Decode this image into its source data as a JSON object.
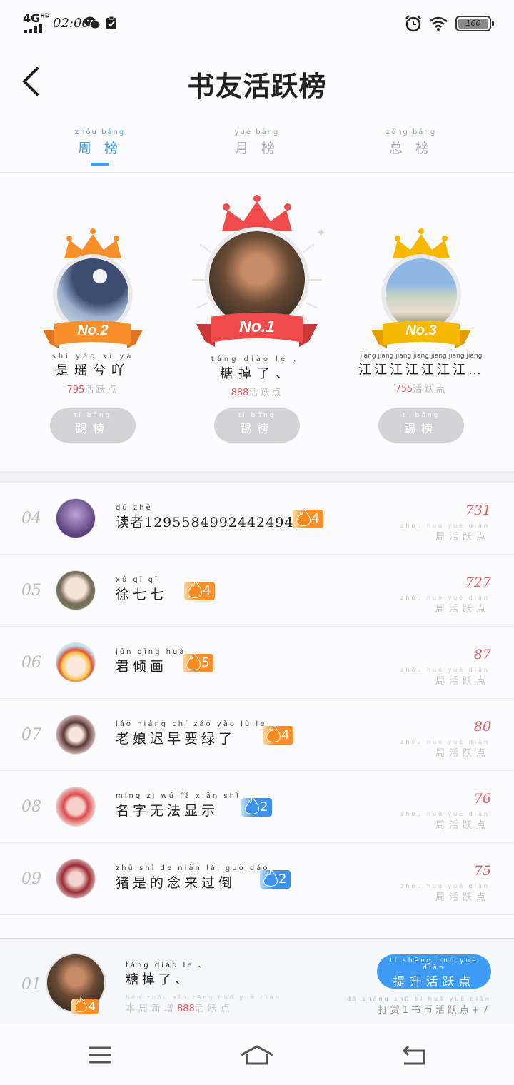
{
  "status": {
    "signal": "4G",
    "signal_sup": "HD",
    "time": "02:06",
    "battery": "100"
  },
  "header": {
    "title": "书友活跃榜"
  },
  "tabs": [
    {
      "pinyin": "zhōu bǎng",
      "label": "周 榜",
      "active": true
    },
    {
      "pinyin": "yuè bǎng",
      "label": "月 榜",
      "active": false
    },
    {
      "pinyin": "zǒng bǎng",
      "label": "总 榜",
      "active": false
    }
  ],
  "podium": {
    "first": {
      "rank_label": "No.1",
      "name_pinyin": "táng diào le 、",
      "name": "糖掉了、",
      "score": "888",
      "score_pinyin": "huó yuè diǎn",
      "score_label": "活跃点",
      "kick_pinyin": "tī bǎng",
      "kick_label": "踢榜"
    },
    "second": {
      "rank_label": "No.2",
      "name_pinyin": "shì yáo xī yā",
      "name": "是瑶兮吖",
      "score": "795",
      "score_pinyin": "huó yuè diǎn",
      "score_label": "活跃点",
      "kick_pinyin": "tī bǎng",
      "kick_label": "踢榜"
    },
    "third": {
      "rank_label": "No.3",
      "name_pinyin": "jiāng jiāng jiāng jiāng jiāng jiāng jiāng",
      "name": "江江江江江江江…",
      "score": "755",
      "score_pinyin": "huó yuè diǎn",
      "score_label": "活跃点",
      "kick_pinyin": "tī bǎng",
      "kick_label": "踢榜"
    }
  },
  "list": [
    {
      "rank": "04",
      "name_pinyin": "dú zhě",
      "name": "读者1295584992442494976",
      "level": "4",
      "level_color": "orange",
      "score": "731",
      "label_pinyin": "zhōu huó yuè diǎn",
      "label": "周活跃点"
    },
    {
      "rank": "05",
      "name_pinyin": "xú qī qī",
      "name": "徐七七",
      "level": "4",
      "level_color": "orange",
      "score": "727",
      "label_pinyin": "zhōu huó yuè diǎn",
      "label": "周活跃点"
    },
    {
      "rank": "06",
      "name_pinyin": "jūn qīng huà",
      "name": "君倾画",
      "level": "5",
      "level_color": "orange",
      "score": "87",
      "label_pinyin": "zhōu huó yuè diǎn",
      "label": "周活跃点"
    },
    {
      "rank": "07",
      "name_pinyin": "lǎo niáng chí zǎo yào lǜ le",
      "name": "老娘迟早要绿了",
      "level": "4",
      "level_color": "orange",
      "score": "80",
      "label_pinyin": "zhōu huó yuè diǎn",
      "label": "周活跃点"
    },
    {
      "rank": "08",
      "name_pinyin": "míng zì wú fǎ xiǎn shì",
      "name": "名字无法显示",
      "level": "2",
      "level_color": "blue",
      "score": "76",
      "label_pinyin": "zhōu huó yuè diǎn",
      "label": "周活跃点"
    },
    {
      "rank": "09",
      "name_pinyin": "zhū shì de niàn lái guò dǎo",
      "name": "猪是的念来过倒",
      "level": "2",
      "level_color": "blue",
      "score": "75",
      "label_pinyin": "zhōu huó yuè diǎn",
      "label": "周活跃点"
    }
  ],
  "mine": {
    "rank": "01",
    "level": "4",
    "name_pinyin": "táng diào le 、",
    "name": "糖掉了、",
    "sub_pinyin": "běn zhōu xīn zēng huó yuè diǎn",
    "sub_prefix": "本周新增",
    "sub_value": "888",
    "sub_suffix": "活跃点",
    "boost_pinyin": "tí shēng huó yuè diǎn",
    "boost_label": "提升活跃点",
    "hint_pinyin": "dǎ shǎng shū bì huó yuè diǎn",
    "hint_label": "打赏1书币活跃点+7"
  },
  "icons": {
    "back": "back-arrow-icon",
    "menu": "menu-icon",
    "home": "home-icon",
    "return": "return-icon"
  },
  "colors": {
    "accent": "#3da0f2",
    "score_red": "#e46363",
    "crown_orange": "#f7902a",
    "crown_red": "#ef4b4b",
    "crown_gold": "#f6b800"
  }
}
